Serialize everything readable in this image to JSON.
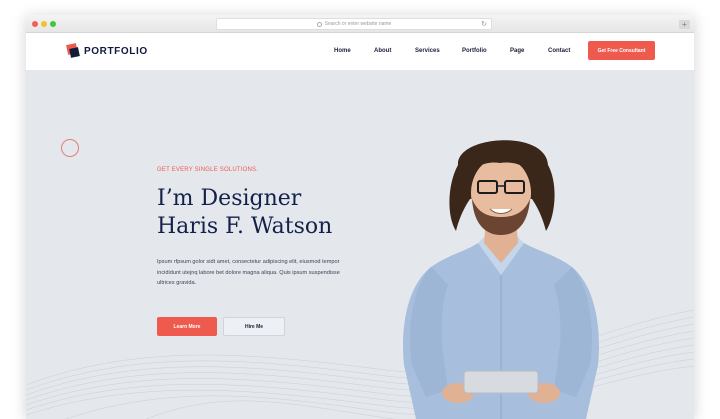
{
  "browser": {
    "address_placeholder": "Search or enter website name",
    "plus_label": "+",
    "reload_glyph": "↻"
  },
  "site": {
    "logo_text": "PORTFOLIO",
    "nav": [
      "Home",
      "About",
      "Services",
      "Portfolio",
      "Page",
      "Contact"
    ],
    "cta": "Get Free Consultant"
  },
  "hero": {
    "tagline": "GET EVERY SINGLE SOLUTIONS.",
    "headline_line1": "I’m Designer",
    "headline_line2": "Haris F. Watson",
    "description": "Ipsum rfpsum golor sidt amet, consectetur adipiscing elit, eiusmod tempor incididunt utejnq labore bet dolore magna aliqua. Quis ipsum suspendisse ultrices gravida.",
    "primary_button": "Learn More",
    "secondary_button": "Hire Me"
  },
  "colors": {
    "accent": "#ef5a4f",
    "navy": "#13214a",
    "hero_bg": "#e4e8ed"
  },
  "icons": [
    "window-close-dot",
    "window-minimize-dot",
    "window-maximize-dot",
    "search-icon",
    "reload-icon",
    "logo-icon"
  ]
}
